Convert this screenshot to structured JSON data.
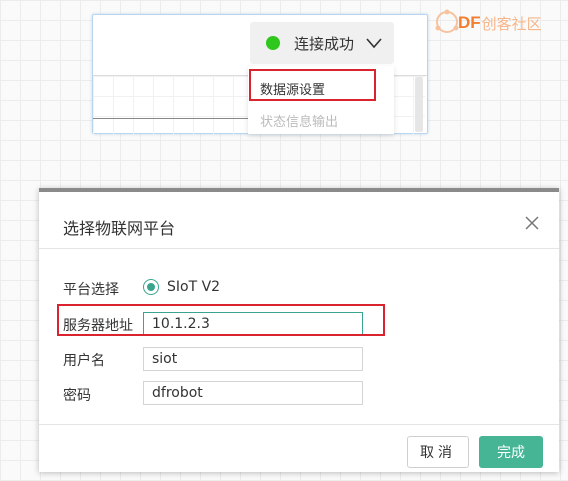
{
  "widget": {
    "status_label": "连接成功",
    "status_color": "#2ec71b",
    "menu": {
      "items": [
        {
          "label": "数据源设置",
          "state": "highlighted"
        },
        {
          "label": "状态信息输出",
          "state": "disabled"
        }
      ]
    }
  },
  "logo": {
    "brand": "DF",
    "text": "创客社区"
  },
  "dialog": {
    "title": "选择物联网平台",
    "platform_label": "平台选择",
    "platform_option": "SIoT V2",
    "server_label": "服务器地址",
    "server_value": "10.1.2.3",
    "username_label": "用户名",
    "username_value": "siot",
    "password_label": "密码",
    "password_value": "dfrobot",
    "cancel_label": "取消",
    "ok_label": "完成"
  },
  "colors": {
    "accent": "#45b595",
    "highlight_box": "#d9232e",
    "brand_orange": "#f27f2f"
  }
}
